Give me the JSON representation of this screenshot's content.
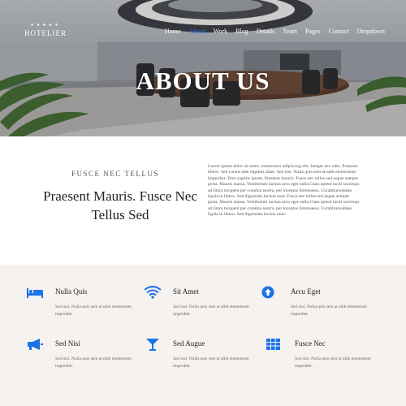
{
  "brand": {
    "stars": "★★★★★",
    "name": "HOTELIER"
  },
  "nav": [
    {
      "label": "Home",
      "active": false
    },
    {
      "label": "About",
      "active": true
    },
    {
      "label": "Work",
      "active": false
    },
    {
      "label": "Blog",
      "active": false
    },
    {
      "label": "Details",
      "active": false
    },
    {
      "label": "Team",
      "active": false
    },
    {
      "label": "Pages",
      "active": false
    },
    {
      "label": "Contact",
      "active": false
    },
    {
      "label": "Dropdown",
      "active": false
    }
  ],
  "hero": {
    "title": "ABOUT US"
  },
  "about": {
    "kicker": "FUSCE NEC TELLUS",
    "heading": "Praesent Mauris. Fusce Nec Tellus Sed",
    "body": "Lorem ipsum dolor sit amet, consectetur adipiscing elit. Integer nec odio. Praesent libero. Sed cursus ante dapibus diam. Sed nisi. Nulla quis sem at nibh elementum imperdiet. Duis sagittis ipsum. Praesent mauris. Fusce nec tellus sed augue semper porta. Mauris massa. Vestibulum lacinia arcu eget nulla.Class aptent taciti sociosqu ad litora torquent per conubia nostra, per inceptos himenaeos. Curabitursodales ligula in libero. Sed dignissim lacinia nunc.Fusce nec tellus sed augue semper porta. Mauris massa. Vestibulum lacinia arcu eget nulla.Class aptent taciti sociosqu ad litora torquent per conubia nostra, per inceptos himenaeos. Curabitursodales ligula in libero. Sed dignissim lacinia nunc."
  },
  "accent_color": "#1a73e8",
  "features": [
    {
      "icon": "bed-icon",
      "title": "Nulla Quis",
      "desc": "Sed nisi. Nulla quis sem at nibh elementum imperdiet."
    },
    {
      "icon": "wifi-icon",
      "title": "Sit Amet",
      "desc": "Sed nisi. Nulla quis sem at nibh elementum imperdiet."
    },
    {
      "icon": "arrow-up-circle-icon",
      "title": "Arcu Eget",
      "desc": "Sed nisi. Nulla quis sem at nibh elementum imperdiet."
    },
    {
      "icon": "megaphone-icon",
      "title": "Sed Nisi",
      "desc": "Sed nisi. Nulla quis sem at nibh elementum imperdiet."
    },
    {
      "icon": "cocktail-icon",
      "title": "Sed Augue",
      "desc": "Sed nisi. Nulla quis sem at nibh elementum imperdiet."
    },
    {
      "icon": "table-grid-icon",
      "title": "Fusce Nec",
      "desc": "Sed nisi. Nulla quis sem at nibh elementum imperdiet."
    }
  ]
}
